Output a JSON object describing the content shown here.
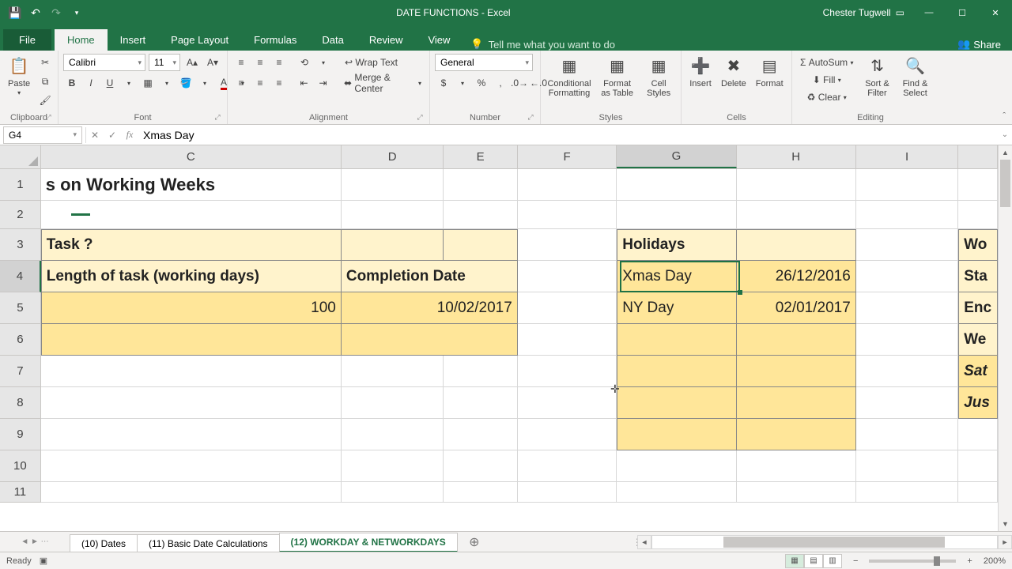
{
  "titlebar": {
    "title": "DATE FUNCTIONS - Excel",
    "user": "Chester Tugwell"
  },
  "tabs": {
    "file": "File",
    "home": "Home",
    "insert": "Insert",
    "page_layout": "Page Layout",
    "formulas": "Formulas",
    "data": "Data",
    "review": "Review",
    "view": "View",
    "tell_me": "Tell me what you want to do",
    "share": "Share"
  },
  "ribbon": {
    "clipboard": {
      "label": "Clipboard",
      "paste": "Paste"
    },
    "font": {
      "label": "Font",
      "name": "Calibri",
      "size": "11"
    },
    "alignment": {
      "label": "Alignment",
      "wrap": "Wrap Text",
      "merge": "Merge & Center"
    },
    "number": {
      "label": "Number",
      "format": "General"
    },
    "styles": {
      "label": "Styles",
      "cond": "Conditional Formatting",
      "table": "Format as Table",
      "cell": "Cell Styles"
    },
    "cells": {
      "label": "Cells",
      "insert": "Insert",
      "delete": "Delete",
      "format": "Format"
    },
    "editing": {
      "label": "Editing",
      "autosum": "AutoSum",
      "fill": "Fill",
      "clear": "Clear",
      "sort": "Sort & Filter",
      "find": "Find & Select"
    }
  },
  "namebox": "G4",
  "formula": "Xmas Day",
  "columns": [
    "C",
    "D",
    "E",
    "F",
    "G",
    "H",
    "I"
  ],
  "rows": [
    "1",
    "2",
    "3",
    "4",
    "5",
    "6",
    "7",
    "8",
    "9",
    "10",
    "11"
  ],
  "cells": {
    "C1": "s on Working Weeks",
    "C3": "Task ?",
    "C4": "Length of task (working days)",
    "D4": "Completion Date",
    "C5": "100",
    "D5": "10/02/2017",
    "G3": "Holidays",
    "G4": "Xmas Day",
    "H4": "26/12/2016",
    "G5": "NY Day",
    "H5": "02/01/2017",
    "J3": "Wo",
    "J4": "Sta",
    "J5": "Enc",
    "J6": "We",
    "J7": "Sat",
    "J8": "Jus"
  },
  "sheets": {
    "s1": "(10) Dates",
    "s2": "(11) Basic Date Calculations",
    "s3": "(12) WORKDAY & NETWORKDAYS"
  },
  "status": {
    "ready": "Ready",
    "zoom": "200%"
  }
}
